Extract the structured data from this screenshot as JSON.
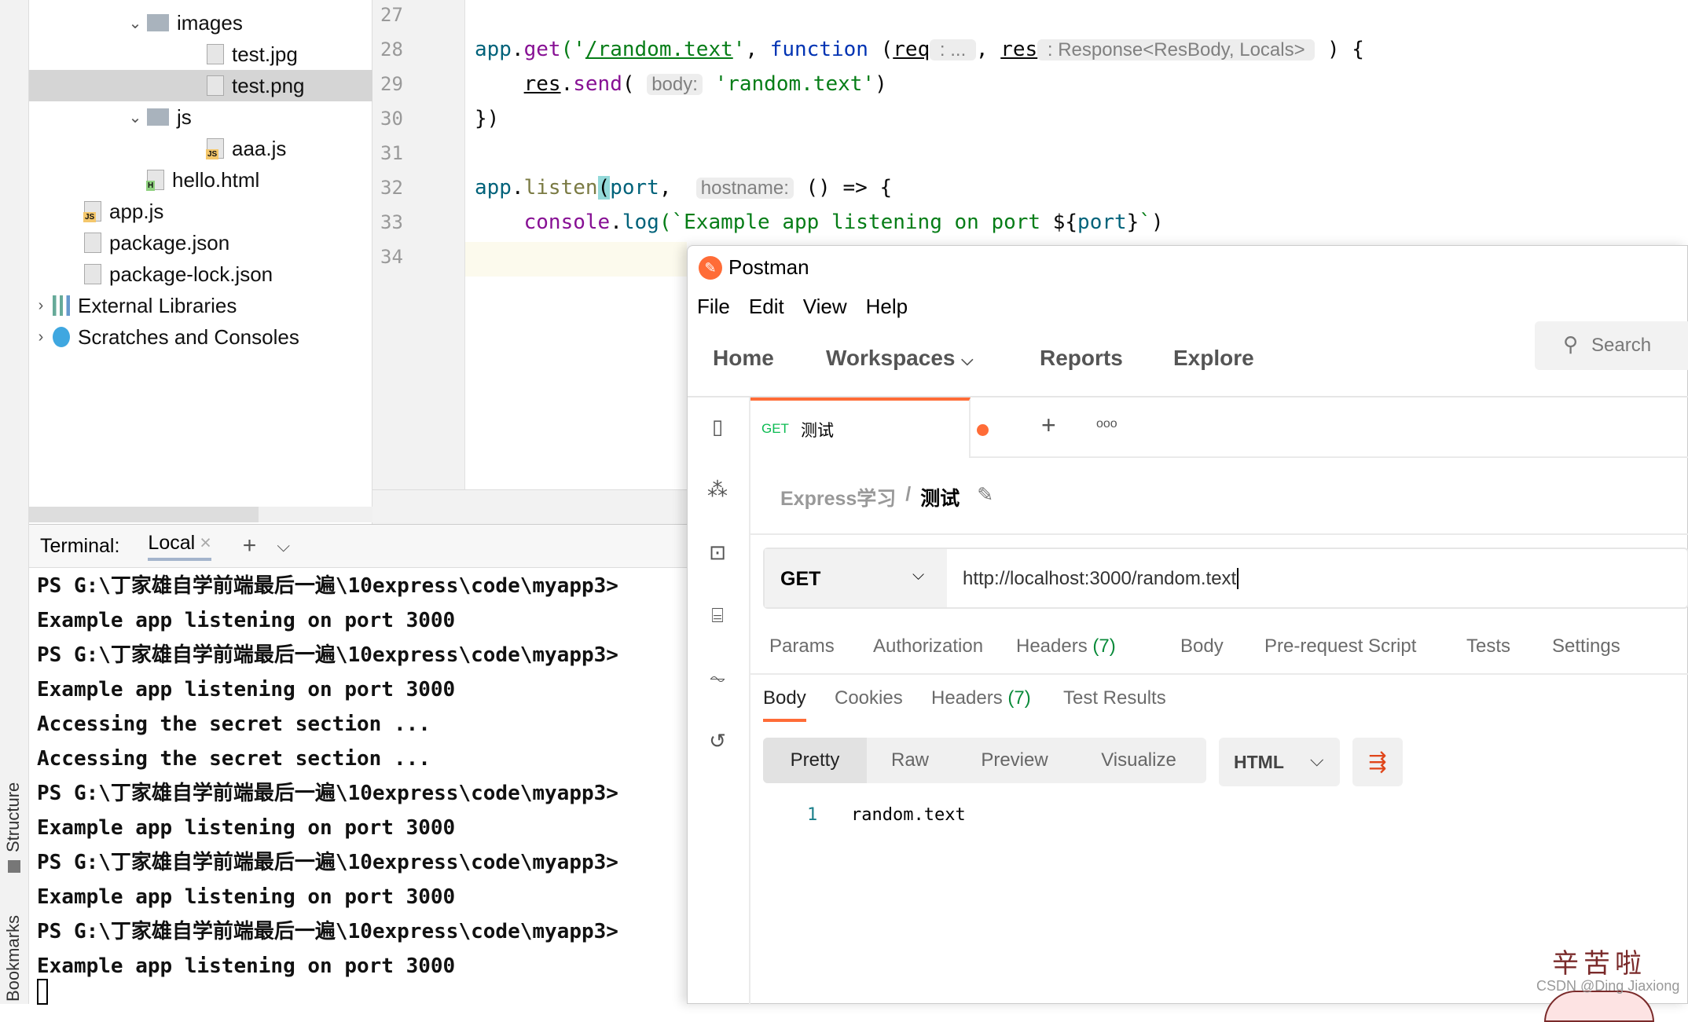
{
  "side_strip": {
    "structure": "Structure",
    "bookmarks": "Bookmarks"
  },
  "tree": [
    {
      "label": "images",
      "type": "folder",
      "depth": 2,
      "expanded": true
    },
    {
      "label": "test.jpg",
      "type": "image",
      "depth": 3
    },
    {
      "label": "test.png",
      "type": "image",
      "depth": 3,
      "selected": true
    },
    {
      "label": "js",
      "type": "folder",
      "depth": 2,
      "expanded": true
    },
    {
      "label": "aaa.js",
      "type": "js",
      "depth": 3
    },
    {
      "label": "hello.html",
      "type": "html",
      "depth": 2
    },
    {
      "label": "app.js",
      "type": "js",
      "depth": 1
    },
    {
      "label": "package.json",
      "type": "json",
      "depth": 1
    },
    {
      "label": "package-lock.json",
      "type": "json",
      "depth": 1
    },
    {
      "label": "External Libraries",
      "type": "lib",
      "depth": 0,
      "collapsed": true
    },
    {
      "label": "Scratches and Consoles",
      "type": "scratch",
      "depth": 0,
      "collapsed": true
    }
  ],
  "editor": {
    "line_numbers": [
      "27",
      "28",
      "29",
      "30",
      "31",
      "32",
      "33",
      "34"
    ],
    "lines": [
      [],
      [
        [
          "app",
          "obj"
        ],
        [
          ".",
          "plain"
        ],
        [
          "get",
          "method"
        ],
        [
          "('",
          "str"
        ],
        [
          "/random.text",
          "strul"
        ],
        [
          "'",
          "str"
        ],
        [
          ", ",
          "plain"
        ],
        [
          "function",
          "kw"
        ],
        [
          " (",
          "plain"
        ],
        [
          "req",
          "ul"
        ],
        [
          " : ... ",
          "hint"
        ],
        [
          ", ",
          "plain"
        ],
        [
          "res",
          "ul"
        ],
        [
          " : Response<ResBody, Locals> ",
          "hint"
        ],
        [
          " ) {",
          "plain"
        ]
      ],
      [
        [
          "    ",
          "plain"
        ],
        [
          "res",
          "ul"
        ],
        [
          ".",
          "plain"
        ],
        [
          "send",
          "method"
        ],
        [
          "( ",
          "plain"
        ],
        [
          "body:",
          "hint"
        ],
        [
          " ",
          "plain"
        ],
        [
          "'random.text'",
          "str"
        ],
        [
          ")",
          "plain"
        ]
      ],
      [
        [
          "})",
          "plain"
        ]
      ],
      [],
      [
        [
          "app",
          "obj"
        ],
        [
          ".",
          "plain"
        ],
        [
          "listen",
          "fn"
        ],
        [
          "(",
          "brace"
        ],
        [
          "port",
          "param"
        ],
        [
          ",  ",
          "plain"
        ],
        [
          "hostname:",
          "hint"
        ],
        [
          " () => {",
          "plain"
        ]
      ],
      [
        [
          "    ",
          "plain"
        ],
        [
          "console",
          "method"
        ],
        [
          ".",
          "plain"
        ],
        [
          "log",
          "obj"
        ],
        [
          "(`Example app listening on port ",
          "str"
        ],
        [
          "${",
          "plain"
        ],
        [
          "port",
          "param"
        ],
        [
          "}",
          "plain"
        ],
        [
          "`",
          "str"
        ],
        [
          ")",
          "plain"
        ]
      ],
      [
        [
          "}",
          "plain"
        ],
        [
          ")",
          "brace"
        ]
      ]
    ]
  },
  "terminal": {
    "title": "Terminal:",
    "tab": "Local",
    "lines": [
      "PS G:\\丁家雄自学前端最后一遍\\10express\\code\\myapp3>",
      "Example app listening on port 3000",
      "PS G:\\丁家雄自学前端最后一遍\\10express\\code\\myapp3>",
      "Example app listening on port 3000",
      "Accessing the secret section ...",
      "Accessing the secret section ...",
      "PS G:\\丁家雄自学前端最后一遍\\10express\\code\\myapp3>",
      "Example app listening on port 3000",
      "PS G:\\丁家雄自学前端最后一遍\\10express\\code\\myapp3>",
      "Example app listening on port 3000",
      "PS G:\\丁家雄自学前端最后一遍\\10express\\code\\myapp3>",
      "Example app listening on port 3000"
    ]
  },
  "postman": {
    "title": "Postman",
    "menu": [
      "File",
      "Edit",
      "View",
      "Help"
    ],
    "nav": {
      "home": "Home",
      "workspaces": "Workspaces",
      "reports": "Reports",
      "explore": "Explore",
      "search": "Search"
    },
    "tab": {
      "method": "GET",
      "name": "测试"
    },
    "breadcrumb": {
      "collection": "Express学习",
      "separator": "/",
      "request": "测试"
    },
    "request": {
      "method": "GET",
      "url": "http://localhost:3000/random.text"
    },
    "request_tabs": [
      "Params",
      "Authorization",
      "Headers",
      "Body",
      "Pre-request Script",
      "Tests",
      "Settings"
    ],
    "request_headers_count": "(7)",
    "response_tabs": [
      "Body",
      "Cookies",
      "Headers",
      "Test Results"
    ],
    "response_headers_count": "(7)",
    "view_modes": [
      "Pretty",
      "Raw",
      "Preview",
      "Visualize"
    ],
    "format": "HTML",
    "response_body": {
      "line": "1",
      "text": "random.text"
    },
    "accent": "#ff6c37"
  },
  "watermark": {
    "sticker_text": "辛苦啦",
    "credit": "CSDN @Ding Jiaxiong"
  }
}
